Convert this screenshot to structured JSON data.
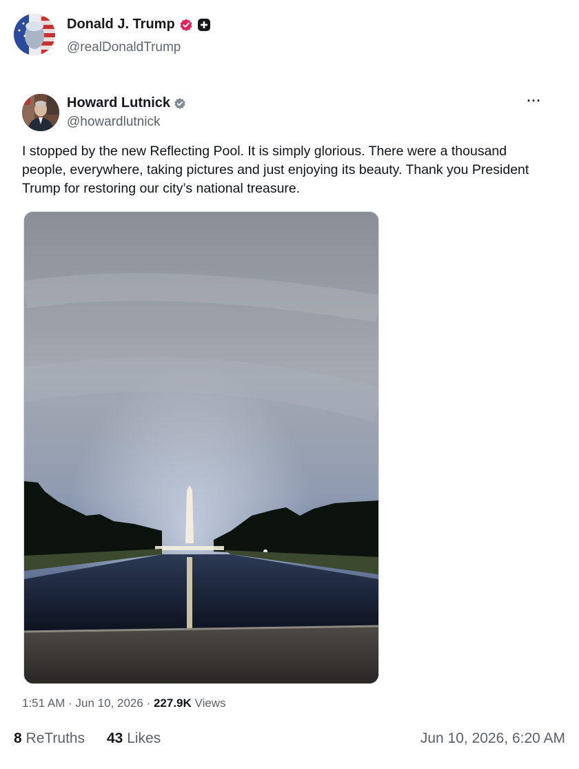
{
  "post": {
    "author_name": "Donald J. Trump",
    "author_handle": "@realDonaldTrump",
    "badge_icon": "verified-badge-icon",
    "badge_color": "#e0245e",
    "plus_icon": "plus-square-icon"
  },
  "quoted": {
    "author_name": "Howard Lutnick",
    "author_handle": "@howardlutnick",
    "verified_color": "#7f8a96",
    "more_label": "···",
    "text": "I stopped by the new Reflecting Pool. It is simply glorious. There were a thousand people, everywhere, taking pictures and just  enjoying its beauty. Thank you President Trump for restoring our city’s national treasure.",
    "time": "1:51 AM",
    "separator": "·",
    "date": "Jun 10, 2026",
    "views_count": "227.9K",
    "views_label": "Views"
  },
  "footer": {
    "retruths_count": "8",
    "retruths_label": "ReTruths",
    "likes_count": "43",
    "likes_label": "Likes",
    "timestamp": "Jun 10, 2026, 6:20 AM"
  }
}
